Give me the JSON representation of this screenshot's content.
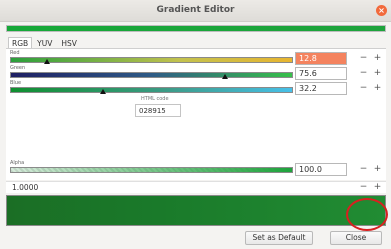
{
  "window": {
    "title": "Gradient Editor"
  },
  "tabs": [
    "RGB",
    "YUV",
    "HSV"
  ],
  "channels": {
    "red": {
      "label": "Red",
      "value": "12.8",
      "level": 0.128
    },
    "green": {
      "label": "Green",
      "value": "75.6",
      "level": 0.756
    },
    "blue": {
      "label": "Blue",
      "value": "32.2",
      "level": 0.322
    },
    "alpha": {
      "label": "Alpha",
      "value": "100.0",
      "level": 1.0
    }
  },
  "html_code": {
    "label": "HTML code",
    "value": "028915"
  },
  "stop_position": "1.0000",
  "buttons": {
    "minus": "−",
    "plus": "+",
    "set_default": "Set as Default",
    "close": "Close"
  },
  "colors": {
    "gradient": "#1e7a2c",
    "highlight": "#f4835f",
    "annotation": "#d82020"
  }
}
